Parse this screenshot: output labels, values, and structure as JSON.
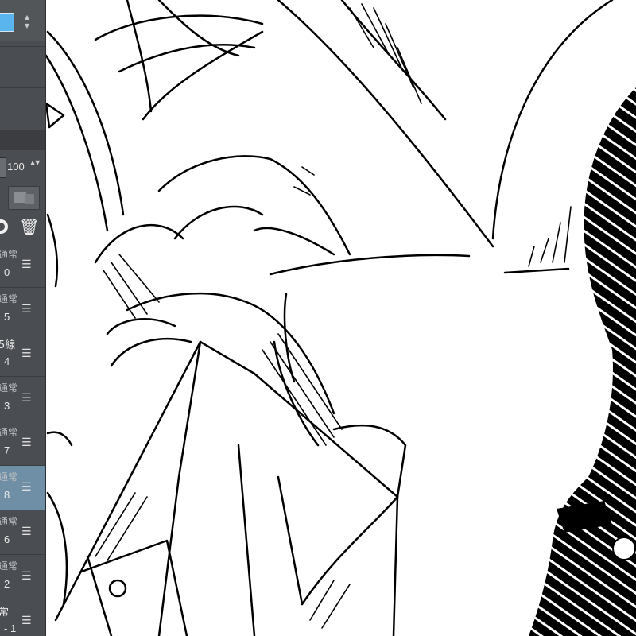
{
  "color_panel": {
    "swatch_color": "#5ab4ee",
    "spin_up": "▲",
    "spin_down": "▼"
  },
  "layer_properties": {
    "opacity_value": "100",
    "opacity_spin": "▲▼",
    "delete_icon": "trash-icon"
  },
  "layers": [
    {
      "mode": "通常",
      "name": "0"
    },
    {
      "mode": "通常",
      "name": "5"
    },
    {
      "mode": "5線",
      "name": "4"
    },
    {
      "mode": "通常",
      "name": "3"
    },
    {
      "mode": "通常",
      "name": "7"
    },
    {
      "mode": "通常",
      "name": "8",
      "selected": true
    },
    {
      "mode": "通常",
      "name": "6"
    },
    {
      "mode": "通常",
      "name": "2"
    },
    {
      "mode": "常",
      "name": "- 1"
    }
  ],
  "menu_glyph": "☰"
}
